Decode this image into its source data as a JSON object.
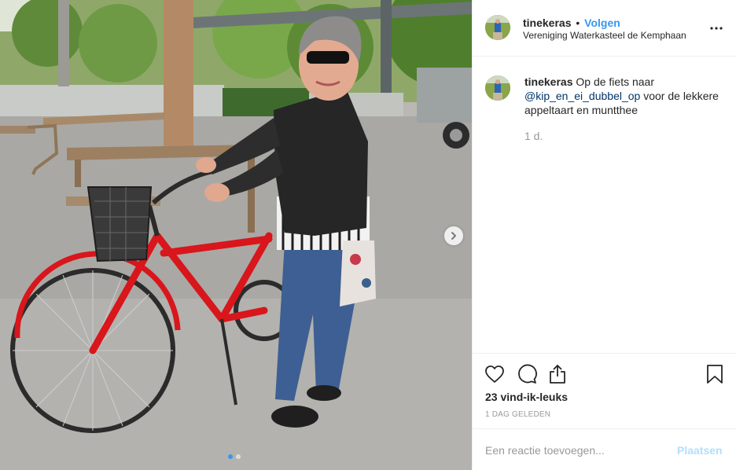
{
  "post": {
    "username": "tinekeras",
    "separator": "•",
    "follow_label": "Volgen",
    "location": "Vereniging Waterkasteel de Kemphaan",
    "caption_username": "tinekeras",
    "caption_text_1": " Op de fiets naar ",
    "caption_mention": "@kip_en_ei_dubbel_op",
    "caption_text_2": " voor de lekkere appeltaart en muntthee",
    "relative_time": "1 d.",
    "likes_text": "23 vind-ik-leuks",
    "date_text": "1 DAG GELEDEN",
    "comment_placeholder": "Een reactie toevoegen...",
    "post_button_label": "Plaatsen"
  },
  "carousel": {
    "slide_count": 2,
    "active_slide": 1
  },
  "icons": {
    "more": "more-options-icon",
    "like": "heart-icon",
    "comment": "comment-bubble-icon",
    "share": "share-icon",
    "save": "bookmark-icon",
    "next": "chevron-right-icon"
  },
  "colors": {
    "link_blue": "#3897f0",
    "mention_blue": "#003569",
    "post_disabled": "#b2dffc",
    "muted": "#999999",
    "bike_red": "#d8161c"
  }
}
